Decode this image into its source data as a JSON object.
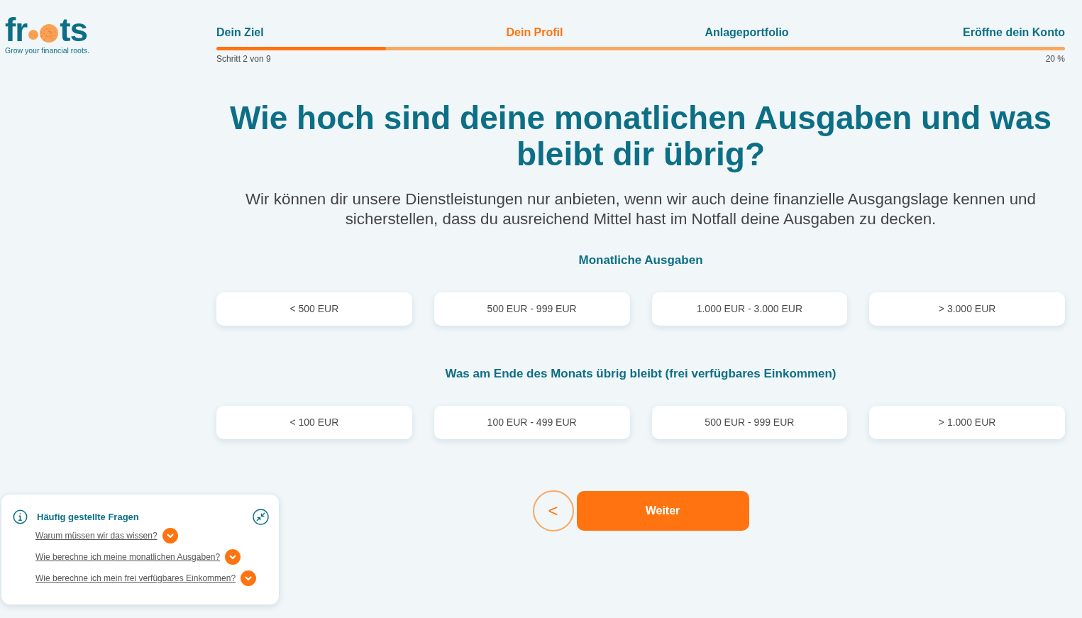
{
  "logo": {
    "text_start": "fr",
    "text_end": "ts",
    "tagline": "Grow your financial roots."
  },
  "stepper": {
    "steps": [
      {
        "label": "Dein Ziel",
        "selected": false
      },
      {
        "label": "Dein Profil",
        "selected": true
      },
      {
        "label": "Anlageportfolio",
        "selected": false
      },
      {
        "label": "Eröffne dein Konto",
        "selected": false
      }
    ],
    "level": 0.2,
    "step_text": "Schritt 2 von 9",
    "percent": "20 %"
  },
  "question": {
    "title": "Wie hoch sind deine monatlichen Ausgaben und was bleibt dir übrig?",
    "description": "Wir können dir unsere Dienstleistungen nur anbieten, wenn wir auch deine finanzielle Ausgangslage kennen und sicherstellen, dass du ausreichend Mittel hast im Notfall deine Ausgaben zu decken."
  },
  "groups": [
    {
      "heading": "Monatliche Ausgaben",
      "options": [
        {
          "label": "< 500 EUR",
          "selected": false
        },
        {
          "label": "500 EUR - 999 EUR",
          "selected": false
        },
        {
          "label": "1.000 EUR - 3.000 EUR",
          "selected": false
        },
        {
          "label": "> 3.000 EUR",
          "selected": false
        }
      ]
    },
    {
      "heading": "Was am Ende des Monats übrig bleibt (frei verfügbares Einkommen)",
      "options": [
        {
          "label": "< 100 EUR",
          "selected": false
        },
        {
          "label": "100 EUR - 499 EUR",
          "selected": false
        },
        {
          "label": "500 EUR - 999 EUR",
          "selected": false
        },
        {
          "label": "> 1.000 EUR",
          "selected": false
        }
      ]
    }
  ],
  "navigation": {
    "back": "<",
    "next": "Weiter"
  },
  "faq": {
    "title": "Häufig gestellte Fragen",
    "items": [
      {
        "question": "Warum müssen wir das wissen?",
        "expanded": false
      },
      {
        "question": "Wie berechne ich meine monatlichen Ausgaben?",
        "expanded": false
      },
      {
        "question": "Wie berechne ich mein frei verfügbares Einkommen?",
        "expanded": false
      }
    ]
  }
}
